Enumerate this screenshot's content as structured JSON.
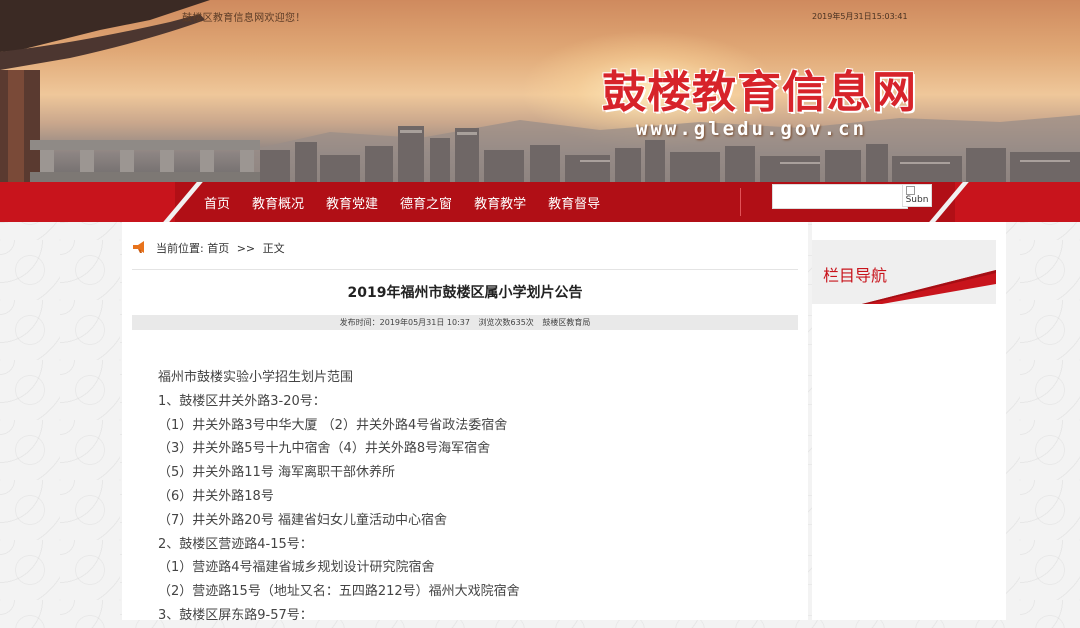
{
  "header": {
    "welcome": "鼓楼区教育信息网欢迎您！",
    "datetime": "2019年5月31日15:03:41",
    "site_title": "鼓楼教育信息网",
    "site_url": "www.gledu.gov.cn"
  },
  "nav": {
    "items": [
      "首页",
      "教育概况",
      "教育党建",
      "德育之窗",
      "教育教学",
      "教育督导"
    ],
    "search_placeholder": "",
    "search_button_alt": "Subn"
  },
  "breadcrumb": {
    "prefix": "当前位置:",
    "home": "首页",
    "separator": ">>",
    "current": "正文"
  },
  "article": {
    "title": "2019年福州市鼓楼区属小学划片公告",
    "meta": {
      "publish_time": "发布时间：2019年05月31日 10:37",
      "views": "浏览次数635次",
      "source": "鼓楼区教育局"
    },
    "lines": [
      "福州市鼓楼实验小学招生划片范围",
      "1、鼓楼区井关外路3-20号：",
      "（1）井关外路3号中华大厦 （2）井关外路4号省政法委宿舍",
      "（3）井关外路5号十九中宿舍（4）井关外路8号海军宿舍",
      "（5）井关外路11号 海军离职干部休养所",
      "（6）井关外路18号",
      "（7）井关外路20号 福建省妇女儿童活动中心宿舍",
      "2、鼓楼区营迹路4-15号：",
      "（1）营迹路4号福建省城乡规划设计研究院宿舍",
      "（2）营迹路15号（地址又名：五四路212号）福州大戏院宿舍",
      "3、鼓楼区屏东路9-57号："
    ]
  },
  "sidebar": {
    "title": "栏目导航"
  },
  "colors": {
    "brand_red": "#c8141c",
    "title_red": "#d7232a"
  }
}
